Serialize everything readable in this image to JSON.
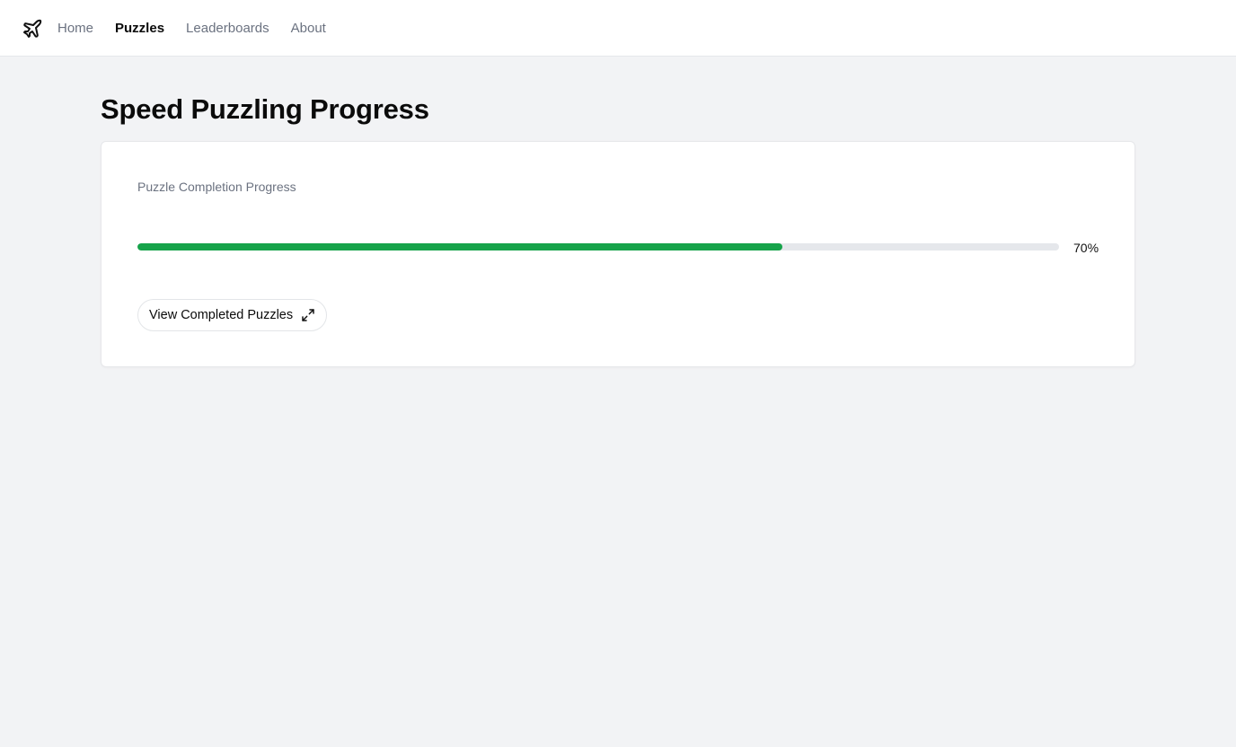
{
  "header": {
    "logo_icon": "plane-icon",
    "nav": [
      {
        "label": "Home",
        "active": false
      },
      {
        "label": "Puzzles",
        "active": true
      },
      {
        "label": "Leaderboards",
        "active": false
      },
      {
        "label": "About",
        "active": false
      }
    ]
  },
  "page": {
    "title": "Speed Puzzling Progress"
  },
  "card": {
    "label": "Puzzle Completion Progress",
    "progress": {
      "percent": 70,
      "percent_text": "70%",
      "fill_color": "#16a34a",
      "track_color": "#e5e7eb"
    },
    "button": {
      "label": "View Completed Puzzles",
      "icon": "expand-icon"
    }
  }
}
